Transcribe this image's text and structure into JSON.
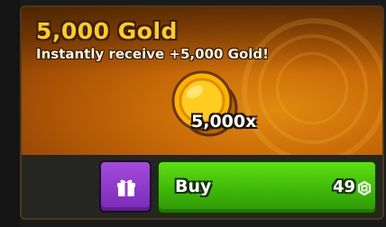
{
  "offer": {
    "title": "5,000 Gold",
    "description": "Instantly receive +5,000 Gold!",
    "quantity_label": "5,000x",
    "icon": "gold-coin-icon"
  },
  "actions": {
    "gift_icon": "gift-icon",
    "buy_label": "Buy",
    "price": "49",
    "currency_icon": "robux-icon"
  },
  "colors": {
    "title": "#ffcc1e",
    "banner": "#c86a08",
    "gift_button": "#8f3bd0",
    "buy_button": "#4cc80c"
  }
}
